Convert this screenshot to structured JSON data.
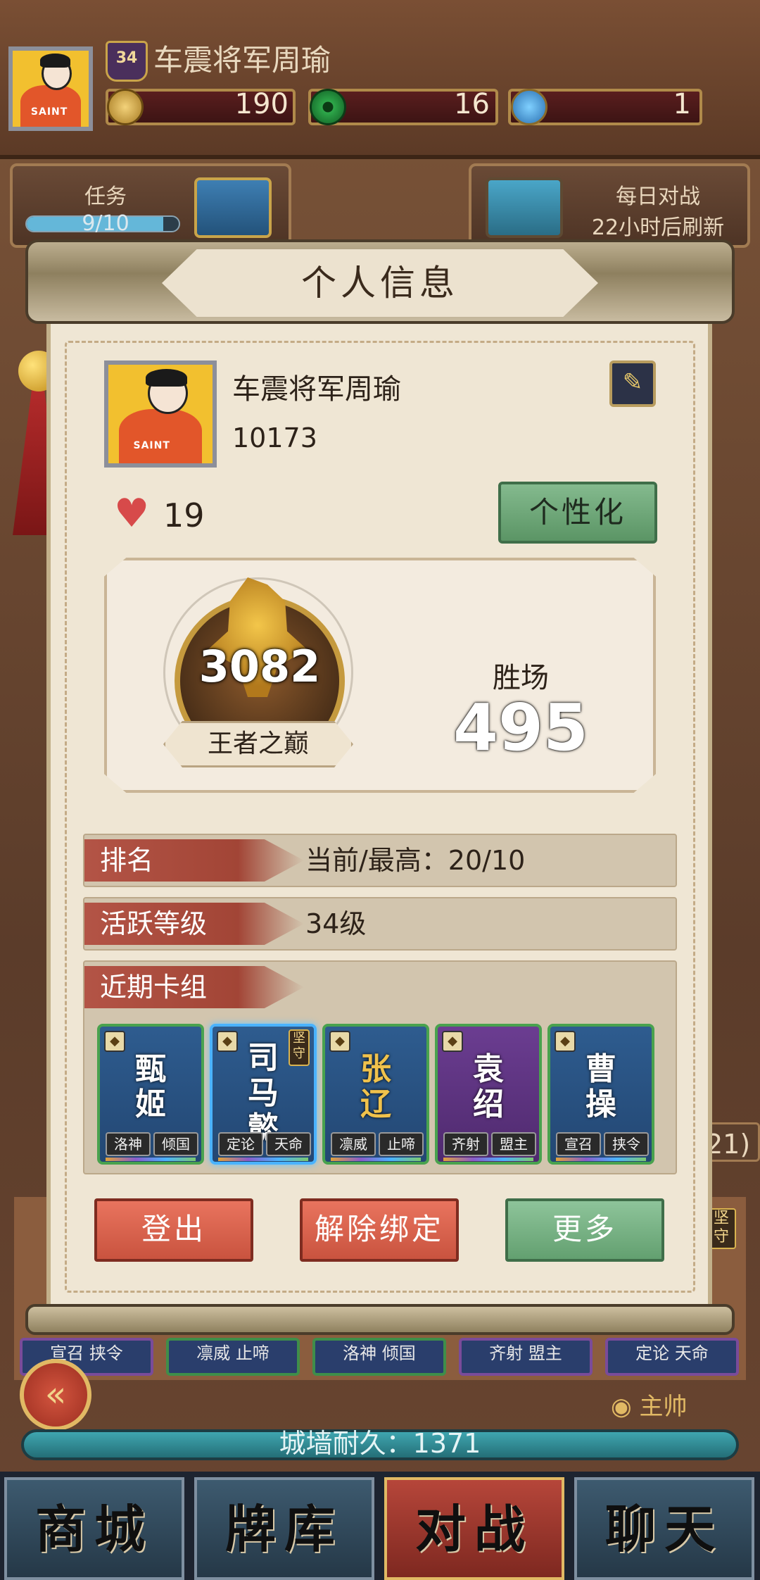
{
  "header": {
    "player_name": "车震将军周瑜",
    "level": "34",
    "gold": "190",
    "jade": "16",
    "gem": "1"
  },
  "side": {
    "task_label": "任务",
    "task_progress": "9/10",
    "task_fill": 0.9,
    "daily_label": "每日对战",
    "daily_refresh": "22小时后刷新"
  },
  "dialog": {
    "title": "个人信息",
    "name": "车震将军周瑜",
    "uid": "10173",
    "likes": "19",
    "personalize": "个性化",
    "rank_score": "3082",
    "rank_name": "王者之巅",
    "wins_label": "胜场",
    "wins": "495",
    "rows": {
      "rank_label": "排名",
      "rank_value": "当前/最高：20/10",
      "active_label": "活跃等级",
      "active_value": "34级",
      "deck_label": "近期卡组"
    },
    "cards": [
      {
        "name": "甄姬",
        "tags": [
          "洛神",
          "倾国"
        ],
        "style": "blue",
        "selected": false
      },
      {
        "name": "司马懿",
        "tags": [
          "定论",
          "天命"
        ],
        "style": "blue",
        "selected": true,
        "badge": "坚守"
      },
      {
        "name": "张辽",
        "tags": [
          "凛威",
          "止啼"
        ],
        "style": "blue",
        "selected": false
      },
      {
        "name": "袁绍",
        "tags": [
          "齐射",
          "盟主"
        ],
        "style": "purple",
        "selected": false
      },
      {
        "name": "曹操",
        "tags": [
          "宣召",
          "挟令"
        ],
        "style": "blue",
        "selected": false
      }
    ],
    "buttons": {
      "logout": "登出",
      "unbind": "解除绑定",
      "more": "更多"
    }
  },
  "background_tags": [
    "宣召",
    "挟令",
    "凛威",
    "止啼",
    "洛神",
    "倾国",
    "齐射",
    "盟主",
    "定论",
    "天命"
  ],
  "background_badge": "坚守",
  "background_count": "21)",
  "commander_label": "主帅",
  "wall": "城墙耐久：1371",
  "nav": [
    "商城",
    "牌库",
    "对战",
    "聊天"
  ],
  "colors": {
    "accent_red": "#b35446",
    "accent_green": "#63a070",
    "parchment": "#efe6d4",
    "gold": "#e1b964"
  }
}
